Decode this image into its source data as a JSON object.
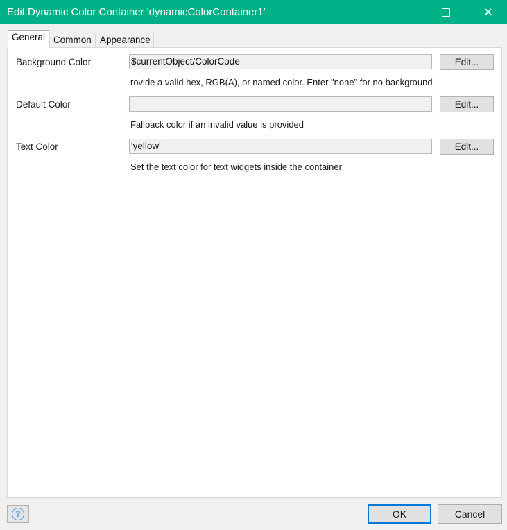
{
  "window": {
    "title": "Edit Dynamic Color Container 'dynamicColorContainer1'",
    "titlebar_color": "#00b188",
    "controls": {
      "minimize_icon": "minimize-icon",
      "maximize_icon": "maximize-icon",
      "close_icon": "close-icon",
      "close_glyph": "✕"
    }
  },
  "tabs": [
    {
      "label": "General",
      "active": true
    },
    {
      "label": "Common",
      "active": false
    },
    {
      "label": "Appearance",
      "active": false
    }
  ],
  "rows": [
    {
      "label": "Background Color",
      "value": "$currentObject/ColorCode",
      "button": "Edit...",
      "hint": "rovide a valid hex, RGB(A), or named color. Enter \"none\" for no background"
    },
    {
      "label": "Default Color",
      "value": "",
      "button": "Edit...",
      "hint": "Fallback color if an invalid value is provided"
    },
    {
      "label": "Text Color",
      "value": "'yellow'",
      "button": "Edit...",
      "hint": "Set the text color for text widgets inside the container"
    }
  ],
  "footer": {
    "help_icon": "help-icon",
    "help_glyph": "?",
    "ok_label": "OK",
    "cancel_label": "Cancel",
    "focus_color": "#0078d7"
  }
}
